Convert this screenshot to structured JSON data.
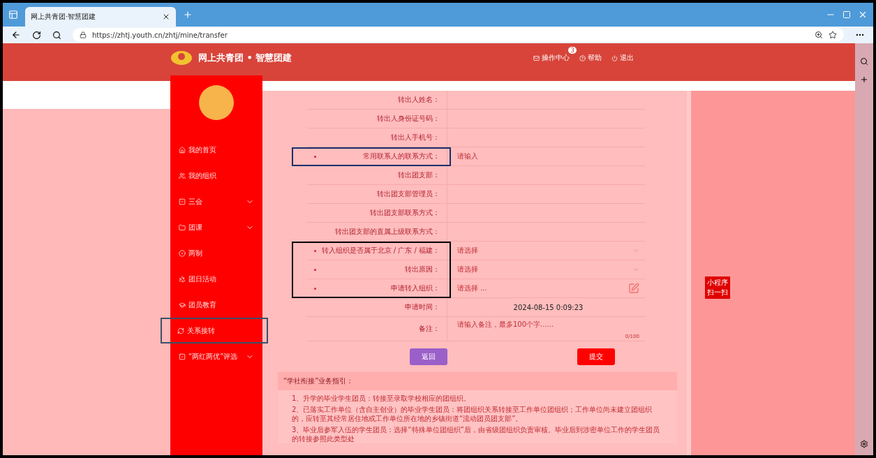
{
  "browser": {
    "tab_title": "网上共青团·智慧团建",
    "url": "https://zhtj.youth.cn/zhtj/mine/transfer"
  },
  "header": {
    "logo_text": "网上共青团 • 智慧团建",
    "nav": [
      {
        "kind": "mail",
        "label": "操作中心",
        "badge": "3"
      },
      {
        "kind": "help",
        "label": "帮助"
      },
      {
        "kind": "exit",
        "label": "退出"
      }
    ]
  },
  "sidebar": {
    "items": [
      {
        "kind": "home",
        "label": "我的首页",
        "expandable": false,
        "selected": false
      },
      {
        "kind": "users",
        "label": "我的组织",
        "expandable": false,
        "selected": false
      },
      {
        "kind": "check",
        "label": "三会",
        "expandable": true,
        "selected": false
      },
      {
        "kind": "folder",
        "label": "团课",
        "expandable": true,
        "selected": false
      },
      {
        "kind": "target",
        "label": "两制",
        "expandable": false,
        "selected": false
      },
      {
        "kind": "recycle",
        "label": "团日活动",
        "expandable": false,
        "selected": false
      },
      {
        "kind": "cap",
        "label": "团员教育",
        "expandable": false,
        "selected": false
      },
      {
        "kind": "refresh",
        "label": "关系接转",
        "expandable": false,
        "selected": true
      },
      {
        "kind": "check",
        "label": "“两红两优”评选",
        "expandable": true,
        "selected": false
      }
    ]
  },
  "form": {
    "groups": [
      {
        "kind": "plain",
        "rows": [
          {
            "kind": "text",
            "label": "转出人姓名：",
            "required": false
          },
          {
            "kind": "text",
            "label": "转出人身份证号码：",
            "required": false
          },
          {
            "kind": "text",
            "label": "转出人手机号：",
            "required": false
          }
        ]
      },
      {
        "kind": "navyframe",
        "rows": [
          {
            "kind": "input",
            "label": "常用联系人的联系方式：",
            "required": true,
            "placeholder": "请输入"
          }
        ]
      },
      {
        "kind": "plain",
        "rows": [
          {
            "kind": "text",
            "label": "转出团支部：",
            "required": false
          },
          {
            "kind": "text",
            "label": "转出团支部管理员：",
            "required": false
          },
          {
            "kind": "text",
            "label": "转出团支部联系方式：",
            "required": false
          },
          {
            "kind": "text",
            "label": "转出团支部的直属上级联系方式：",
            "required": false
          }
        ]
      },
      {
        "kind": "blackframe",
        "rows": [
          {
            "kind": "select",
            "label": "转入组织是否属于北京 / 广东 / 福建：",
            "required": true,
            "placeholder": "请选择"
          },
          {
            "kind": "select",
            "label": "转出原因：",
            "required": true,
            "placeholder": "请选择"
          },
          {
            "kind": "picker",
            "label": "申请转入组织：",
            "required": true,
            "placeholder": "请选择 ..."
          }
        ]
      },
      {
        "kind": "plain",
        "rows": [
          {
            "kind": "value",
            "label": "申请时间：",
            "required": false,
            "value": "2024-08-15 0:09:23"
          },
          {
            "kind": "textarea",
            "label": "备注：",
            "required": false,
            "placeholder": "请输入备注，最多100个字......",
            "counter": "0/100"
          }
        ]
      }
    ],
    "buttons": [
      {
        "kind": "back",
        "label": "返回"
      },
      {
        "kind": "submit",
        "label": "提交"
      }
    ]
  },
  "guide": {
    "title": "“学社衔接”业务指引：",
    "items": [
      "1、升学的毕业学生团员：转接至录取学校相应的团组织。",
      "2、已落实工作单位（含自主创业）的毕业学生团员：将团组织关系转接至工作单位团组织；工作单位尚未建立团组织的，应转至其经常居住地或工作单位所在地的乡镇街道“流动团员团支部”。",
      "3、毕业后参军入伍的学生团员：选择“特殊单位团组织”后，由省级团组织负责审核。毕业后到涉密单位工作的学生团员的转接参照此类型处"
    ]
  },
  "mini_program": {
    "lines": [
      "小程序",
      "扫一扫"
    ]
  }
}
